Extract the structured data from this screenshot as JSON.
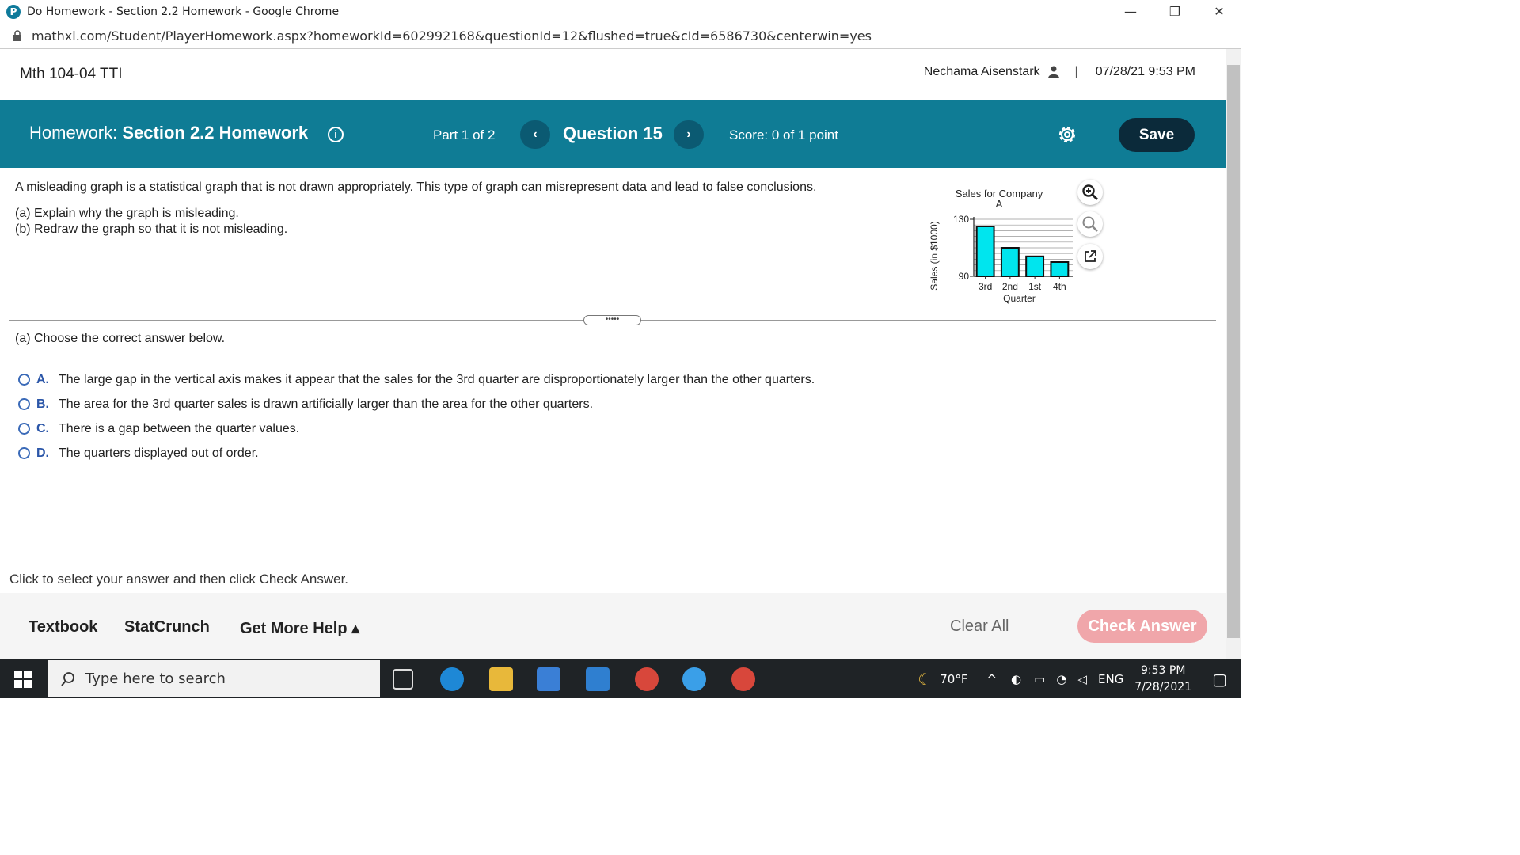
{
  "browser": {
    "title": "Do Homework - Section 2.2 Homework - Google Chrome",
    "url": "mathxl.com/Student/PlayerHomework.aspx?homeworkId=602992168&questionId=12&flushed=true&cId=6586730&centerwin=yes",
    "logo_letter": "P"
  },
  "header": {
    "course": "Mth 104-04 TTI",
    "user": "Nechama Aisenstark",
    "separator": "|",
    "datetime": "07/28/21 9:53 PM"
  },
  "banner": {
    "hw_prefix": "Homework:",
    "hw_name": "Section 2.2 Homework",
    "info": "i",
    "part": "Part 1 of 2",
    "prev": "‹",
    "question": "Question 15",
    "next": "›",
    "score": "Score: 0 of 1 point",
    "save_label": "Save"
  },
  "question": {
    "intro": "A misleading graph is a statistical graph that is not drawn appropriately. This type of graph can misrepresent data and lead to false conclusions.",
    "a": "(a) Explain why the graph is misleading.",
    "b": "(b) Redraw the graph so that it is not misleading."
  },
  "chart_data": {
    "type": "bar",
    "title": "Sales for Company A",
    "xlabel": "Quarter",
    "ylabel": "Sales (in $1000)",
    "categories": [
      "3rd",
      "2nd",
      "1st",
      "4th"
    ],
    "values": [
      125,
      110,
      104,
      100
    ],
    "ylim": [
      90,
      130
    ],
    "yticks": [
      90,
      130
    ],
    "grid": true,
    "bar_color": "#00e5ee"
  },
  "divider_grip": "•••••",
  "partA": {
    "prompt": "(a) Choose the correct answer below.",
    "choices": [
      {
        "letter": "A.",
        "text": "The large gap in the vertical axis makes it appear that the sales for the 3rd quarter are disproportionately larger than the other quarters."
      },
      {
        "letter": "B.",
        "text": "The area for the 3rd quarter sales is drawn artificially larger than the area for the other quarters."
      },
      {
        "letter": "C.",
        "text": "There is a gap between the quarter values."
      },
      {
        "letter": "D.",
        "text": "The quarters displayed out of order."
      }
    ]
  },
  "instruction": "Click to select your answer and then click Check Answer.",
  "footer": {
    "textbook": "Textbook",
    "statcrunch": "StatCrunch",
    "more_help": "Get More Help ▴",
    "clear_all": "Clear All",
    "check_answer": "Check Answer"
  },
  "taskbar": {
    "search_placeholder": "Type here to search",
    "weather": "70°F",
    "lang": "ENG",
    "time": "9:53 PM",
    "date": "7/28/2021"
  },
  "colors": {
    "banner": "#0f7c95",
    "save": "#0b2a3a",
    "check_answer": "#f0a6aa",
    "choice_letter": "#2b56a8"
  }
}
